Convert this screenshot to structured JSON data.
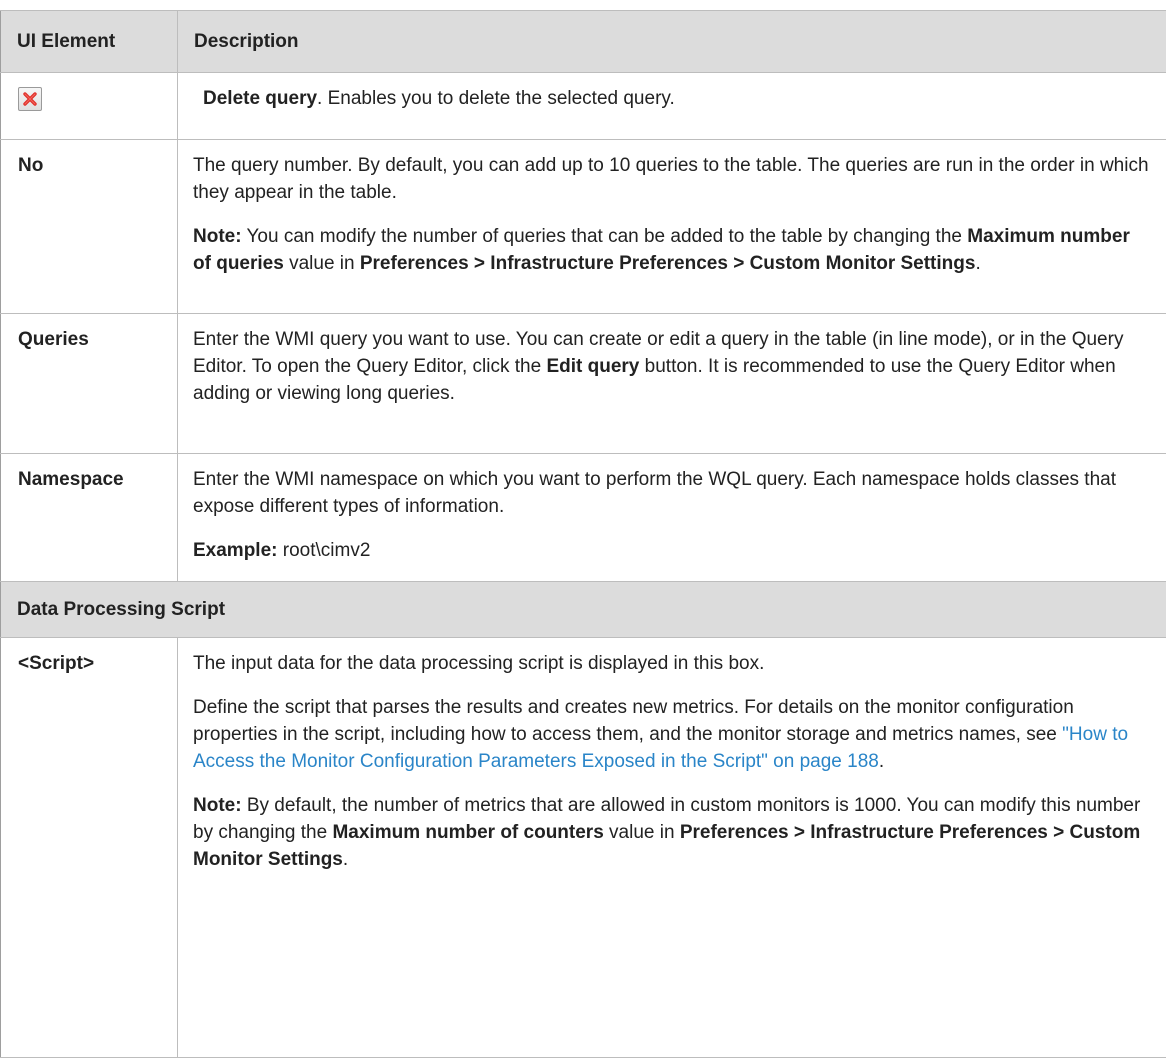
{
  "header": {
    "col1": "UI Element",
    "col2": "Description"
  },
  "rows": {
    "delete": {
      "icon": "delete-x-icon",
      "bold": "Delete query",
      "rest": ". Enables you to delete the selected query."
    },
    "no": {
      "label": "No",
      "p1": "The query number. By default, you can add up to 10 queries to the table. The queries are run in the order in which they appear in the table.",
      "note_label": "Note:",
      "note_t1": " You can modify the number of queries that can be added to the table by changing the ",
      "note_b1": "Maximum number of queries",
      "note_t2": " value in ",
      "note_b2": "Preferences > Infrastructure Preferences > Custom Monitor Settings",
      "note_t3": "."
    },
    "queries": {
      "label": "Queries",
      "t1": "Enter the WMI query you want to use. You can create or edit a query in the table (in line mode), or in the Query Editor. To open the Query Editor, click the ",
      "b1": "Edit query",
      "t2": " button. It is recommended to use the Query Editor when adding or viewing long queries."
    },
    "namespace": {
      "label": "Namespace",
      "p1": "Enter the WMI namespace on which you want to perform the WQL query. Each namespace holds classes that expose different types of information.",
      "example_label": "Example:",
      "example_value": " root\\cimv2"
    },
    "section": {
      "label": "Data Processing Script"
    },
    "script": {
      "label": "<Script>",
      "p1": "The input data for the data processing script is displayed in this box.",
      "p2_t1": "Define the script that parses the results and creates new metrics. For details on the monitor configuration properties in the script, including how to access them, and the monitor storage and metrics names, see ",
      "p2_link": "\"How to Access the Monitor Configuration Parameters Exposed in the Script\" on page 188",
      "p2_t2": ".",
      "note_label": "Note:",
      "note_t1": " By default, the number of metrics that are allowed in custom monitors is 1000. You can modify this number by changing the ",
      "note_b1": "Maximum number of counters",
      "note_t2": " value in ",
      "note_b2": "Preferences > Infrastructure Preferences > Custom Monitor Settings",
      "note_t3": "."
    }
  },
  "colors": {
    "header_bg": "#dcdcdc",
    "link": "#2a85c8",
    "delete_icon": "#e0302a"
  }
}
